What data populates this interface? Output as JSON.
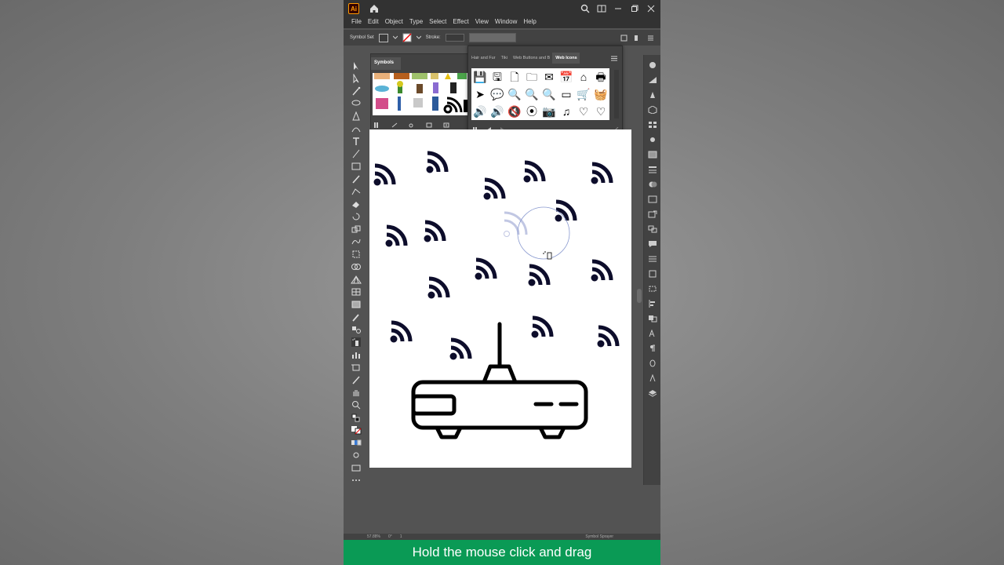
{
  "app": {
    "logo_text": "Ai",
    "menus": [
      "File",
      "Edit",
      "Object",
      "Type",
      "Select",
      "Effect",
      "View",
      "Window",
      "Help"
    ]
  },
  "controlbar": {
    "symbol_set_label": "Symbol Set",
    "stroke_label": "Stroke:"
  },
  "symbols_panel": {
    "tab_label": "Symbols"
  },
  "webicons_panel": {
    "tabs": [
      "Hair and Fur",
      "Tiki",
      "Web Buttons and B",
      "Web Icons"
    ],
    "active_tab": "Web Icons",
    "icons": [
      "💾",
      "🖫",
      "🗋",
      "🗀",
      "✉",
      "📅",
      "⌂",
      "🖶",
      "➤",
      "💬",
      "🔍",
      "🔍",
      "🔍",
      "▭",
      "🛒",
      "🧺",
      "🔊",
      "🔊",
      "🔇",
      "⦿",
      "📷",
      "♫",
      "♡",
      "♡"
    ]
  },
  "statusbar": {
    "zoom": "57.88%",
    "rotation": "0°",
    "artboard": "1",
    "tool_name": "Symbol Sprayer"
  },
  "caption": {
    "text": "Hold the mouse click and drag"
  },
  "colors": {
    "accent_caption": "#0a9a55",
    "ui_dark": "#323232",
    "ui_panel": "#424242",
    "ui_bg": "#535353",
    "rss_fill": "#0d0d2b"
  }
}
